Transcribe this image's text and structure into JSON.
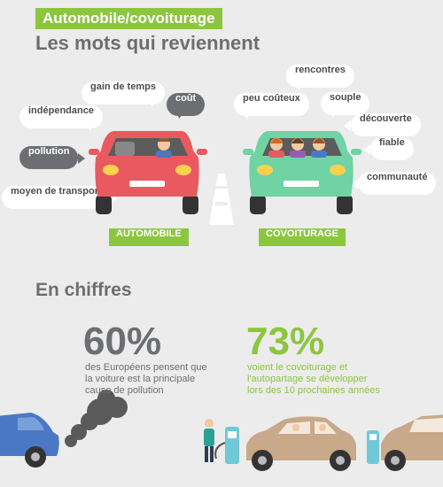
{
  "header": {
    "tag": "Automobile/covoiturage",
    "title": "Les mots qui reviennent"
  },
  "words_left": {
    "gain": "gain de temps",
    "cout": "coût",
    "independance": "indépendance",
    "pollution": "pollution",
    "moyen": "moyen de transport"
  },
  "words_right": {
    "rencontres": "rencontres",
    "peu_couteux": "peu coûteux",
    "souple": "souple",
    "decouverte": "découverte",
    "fiable": "fiable",
    "communaute": "communauté"
  },
  "labels": {
    "left": "AUTOMOBILE",
    "right": "COVOITURAGE"
  },
  "figures": {
    "title": "En chiffres",
    "left": {
      "value": "60%",
      "text": "des Européens pensent que la voiture est la principale cause de pollution"
    },
    "right": {
      "value": "73%",
      "text": "voient le covoiturage et l'autopartage se développer lors des 10 prochaines années"
    }
  },
  "colors": {
    "green": "#8cc63f",
    "red_car": "#e85a5f",
    "mint_car": "#6fd3a3",
    "blue_car": "#4a78c4",
    "beige_car": "#c8a98a",
    "gray_text": "#6d6e71"
  }
}
